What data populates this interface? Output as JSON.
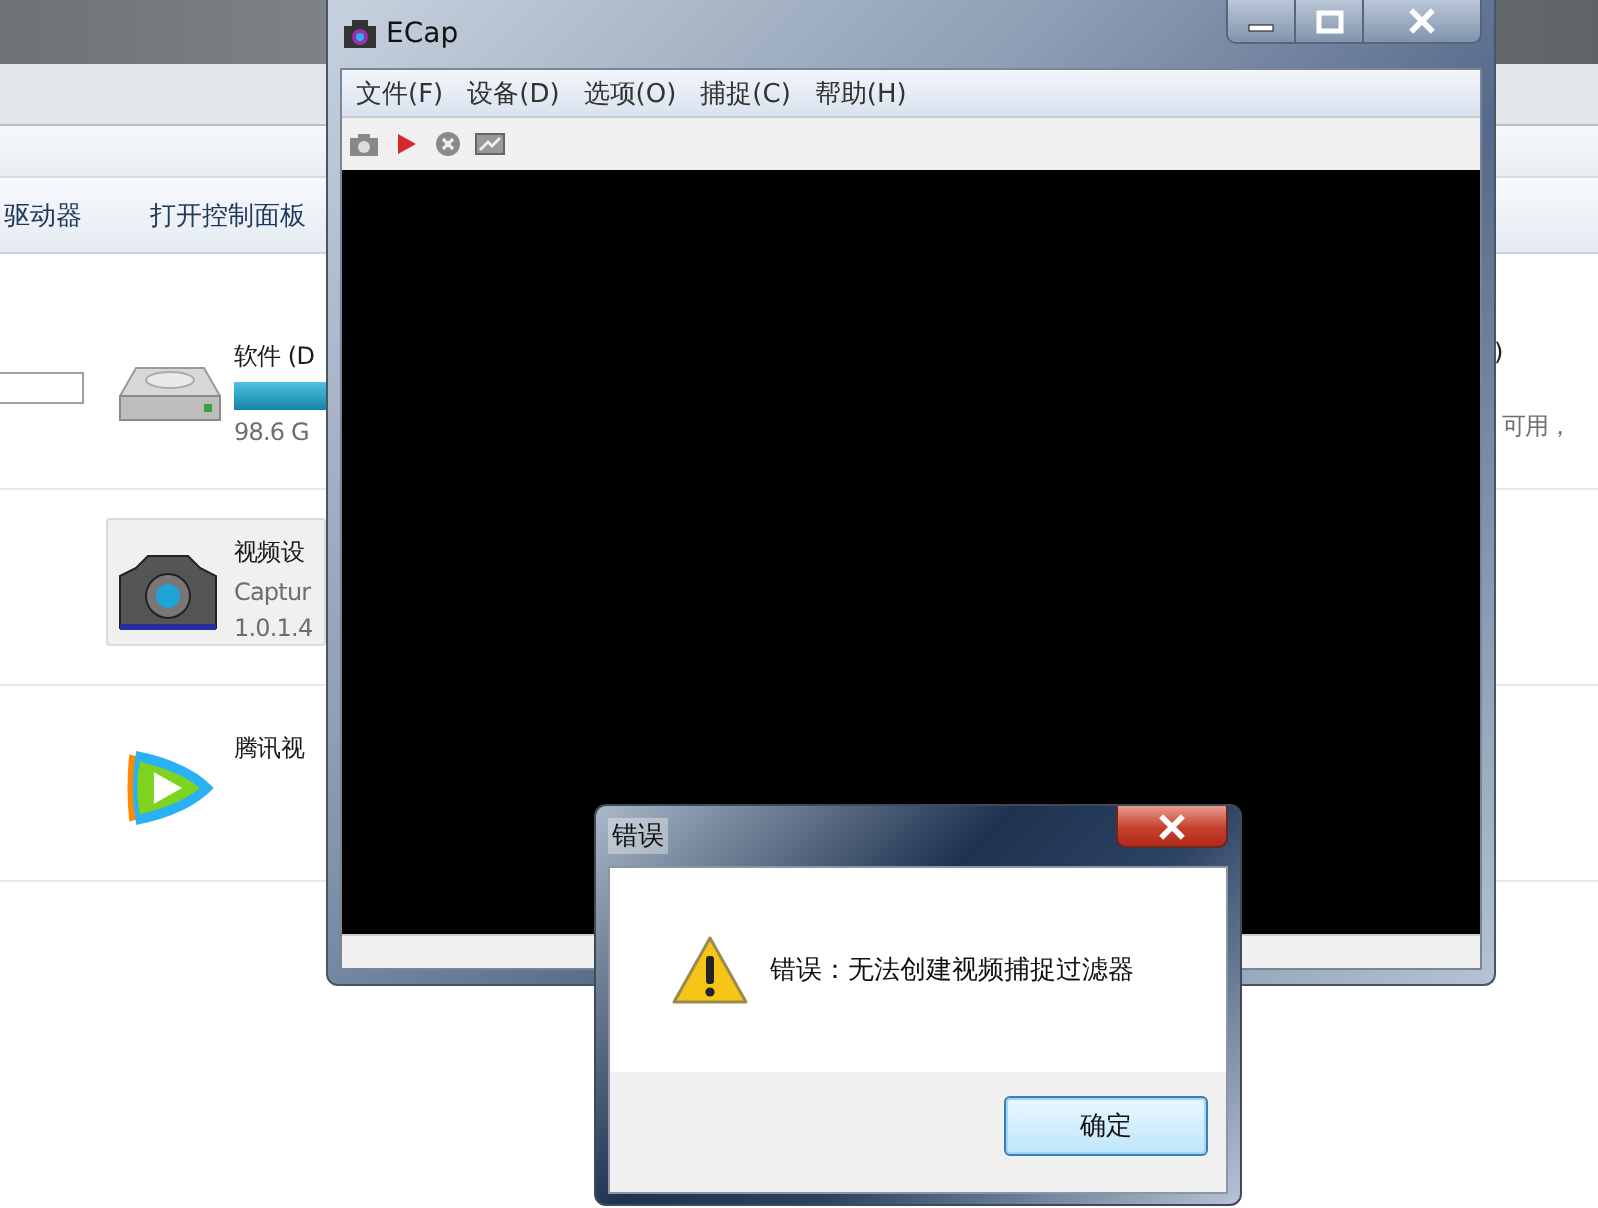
{
  "explorer": {
    "toolbar": [
      {
        "label": "驱动器"
      },
      {
        "label": "打开控制面板"
      }
    ],
    "items": [
      {
        "kind": "drive",
        "name": "软件 (D",
        "detail": "98.6 G",
        "right_name": ")",
        "right_detail": "可用，",
        "selected": false
      },
      {
        "kind": "camera",
        "name": "视频设",
        "lines": [
          "Captur",
          "1.0.1.4"
        ],
        "selected": true
      },
      {
        "kind": "player",
        "name": "腾讯视",
        "selected": false
      }
    ]
  },
  "ecap": {
    "title": "ECap",
    "menu": [
      "文件(F)",
      "设备(D)",
      "选项(O)",
      "捕捉(C)",
      "帮助(H)"
    ]
  },
  "dialog": {
    "title": "错误",
    "message": "错误：无法创建视频捕捉过滤器",
    "button": "确定"
  }
}
